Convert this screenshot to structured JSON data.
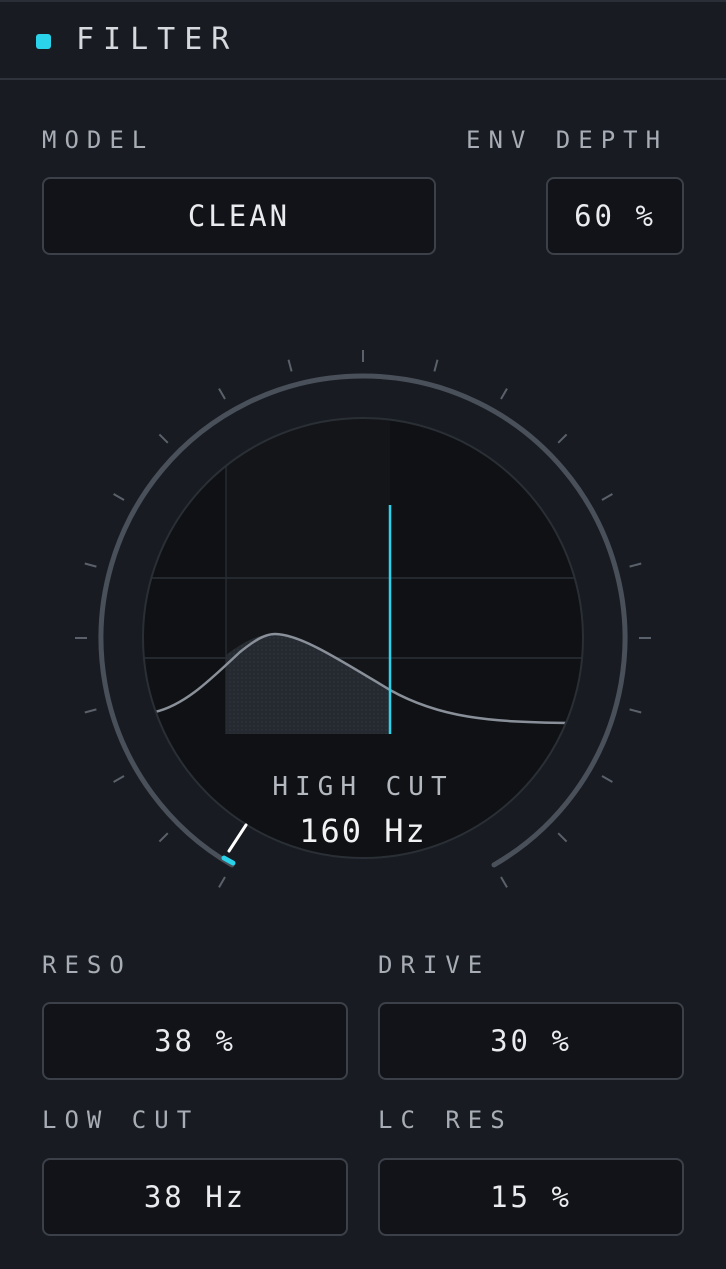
{
  "header": {
    "title": "FILTER",
    "accent_color": "#2ad2ea"
  },
  "model": {
    "label": "MODEL",
    "value": "CLEAN"
  },
  "env_depth": {
    "label": "ENV DEPTH",
    "value": "60 %"
  },
  "high_cut": {
    "label": "HIGH CUT",
    "value": "160 Hz",
    "knob_fraction": 0.0
  },
  "reso": {
    "label": "RESO",
    "value": "38 %"
  },
  "drive": {
    "label": "DRIVE",
    "value": "30 %"
  },
  "low_cut": {
    "label": "LOW CUT",
    "value": "38 Hz"
  },
  "lc_res": {
    "label": "LC RES",
    "value": "15 %"
  },
  "colors": {
    "accent": "#2ad2ea",
    "background": "#181c22",
    "field": "#111318",
    "curve": "#8a9099"
  }
}
